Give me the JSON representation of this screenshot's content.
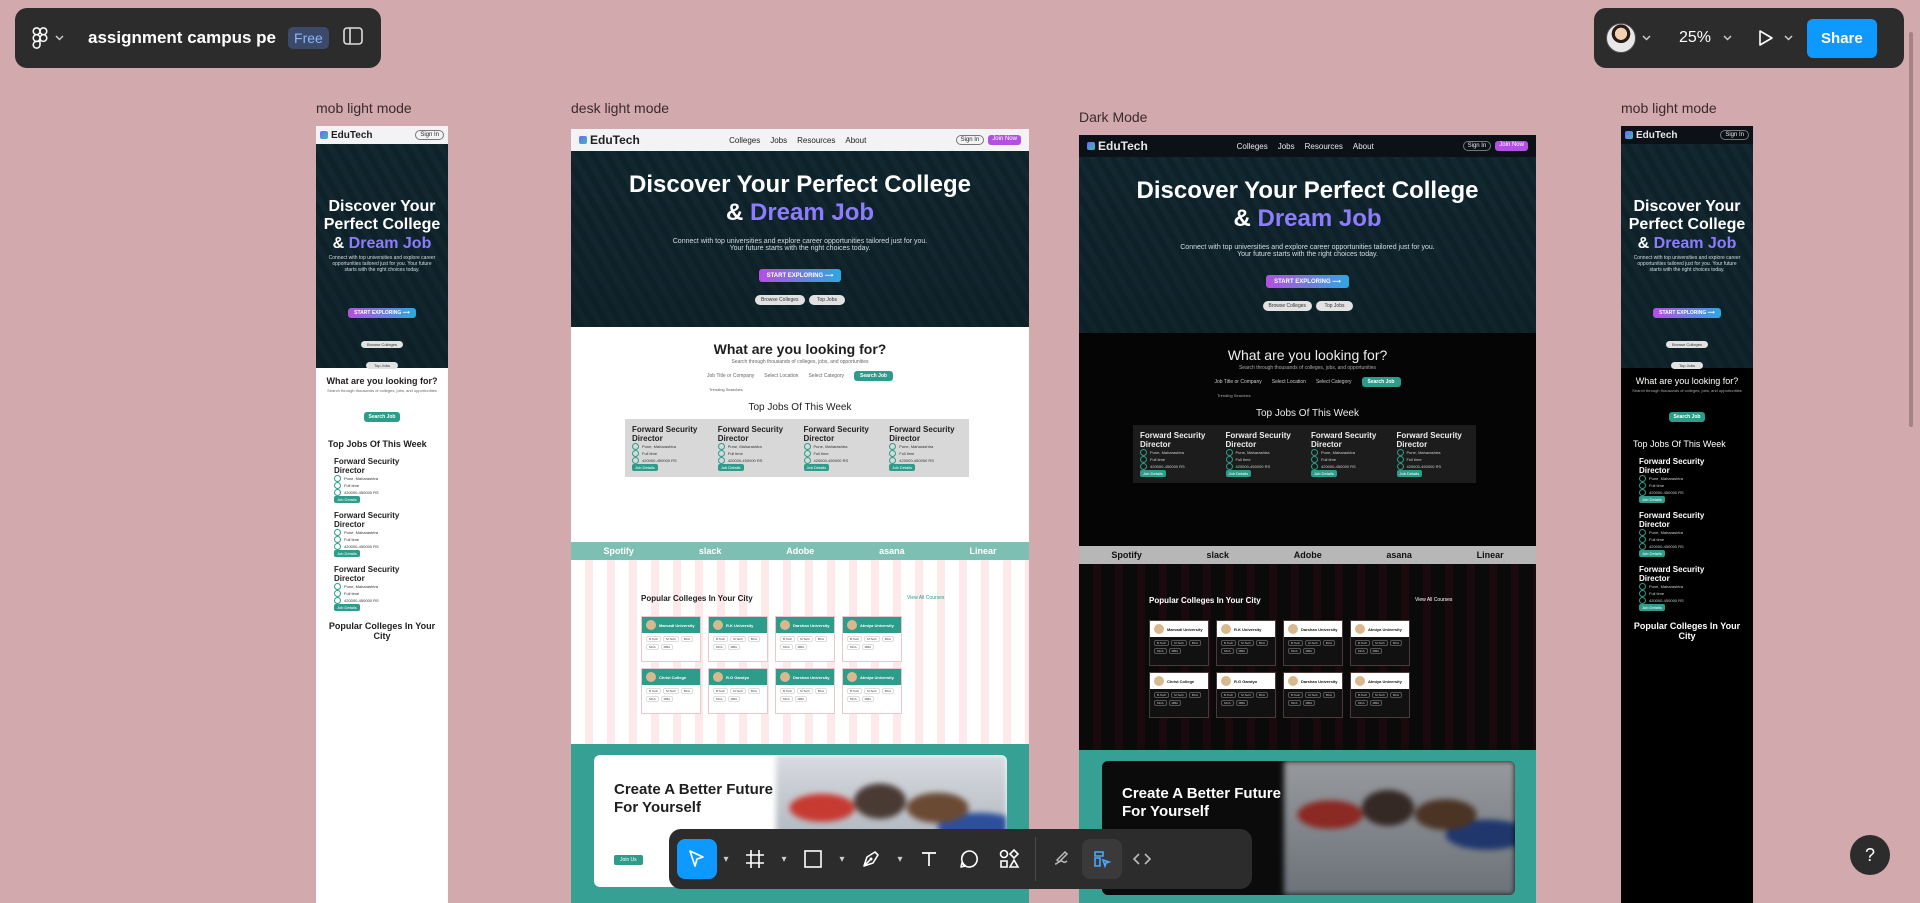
{
  "app": {
    "file_title": "assignment campus pe",
    "plan": "Free",
    "zoom": "25%",
    "share_label": "Share",
    "help": "?"
  },
  "frames": {
    "mob1_label": "mob light mode",
    "desk_label": "desk light mode",
    "dark_label": "Dark Mode",
    "mob2_label": "mob light mode"
  },
  "site": {
    "brand": "EduTech",
    "nav_links": [
      "Colleges",
      "Jobs",
      "Resources",
      "About"
    ],
    "signin": "Sign In",
    "join": "Join Now",
    "hero_title_1": "Discover Your Perfect College",
    "hero_title_amp": "&",
    "hero_title_2": "Dream Job",
    "mob_hero_title_1": "Discover Your Perfect College",
    "hero_sub": "Connect with top universities and explore career opportunities tailored just for you. Your future starts with the right choices today.",
    "cta": "START EXPLORING ⟶",
    "pill_1": "Browse Colleges",
    "pill_2": "Top Jobs",
    "search_title": "What are you looking for?",
    "search_sub": "Search through thousands of colleges, jobs, and opportunities",
    "f_job": "Job Title or Company",
    "f_loc": "Select Location",
    "f_cat": "Select Category",
    "search_btn": "Search Job",
    "trending": "Trending Searches",
    "jobs_title": "Top Jobs Of This Week",
    "job_title": "Forward Security Director",
    "job_loc": "Pune, Maharashtra",
    "job_type": "Full time",
    "job_salary": "420000-450000 RS",
    "job_btn": "Job Details",
    "brands": [
      "Spotify",
      "slack",
      "Adobe",
      "asana",
      "Linear"
    ],
    "colleges_title": "Popular Colleges In Your City",
    "view_all": "View All Courses",
    "colleges": [
      "Marvadi University",
      "R.K University",
      "Darshan University",
      "Atmiya University",
      "Christ College",
      "R.G Gandyo",
      "Darshan University",
      "Atmiya University"
    ],
    "tags": [
      "B.Tech",
      "M.Tech",
      "BCA",
      "MCA",
      "MBA"
    ],
    "future_title": "Create A Better Future For Yourself",
    "future_btn": "Join Us"
  },
  "toolbar": {
    "tools": [
      "move-tool",
      "frame-tool",
      "rectangle-tool",
      "pen-tool",
      "text-tool",
      "comment-tool",
      "actions-tool"
    ],
    "modes": [
      "draw-mode",
      "design-mode",
      "dev-mode"
    ]
  }
}
